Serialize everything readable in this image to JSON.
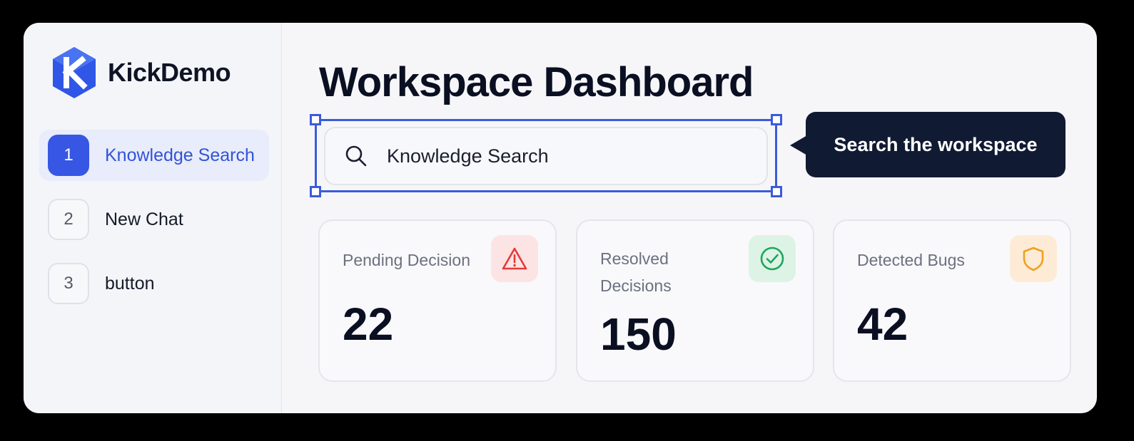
{
  "app": {
    "name": "KickDemo",
    "brand_color": "#3756e3"
  },
  "sidebar": {
    "items": [
      {
        "number": "1",
        "label": "Knowledge Search",
        "active": true
      },
      {
        "number": "2",
        "label": "New Chat",
        "active": false
      },
      {
        "number": "3",
        "label": "button",
        "active": false
      }
    ]
  },
  "main": {
    "title": "Workspace Dashboard",
    "search": {
      "value": "Knowledge Search",
      "icon": "search-icon"
    },
    "tooltip": {
      "text": "Search the workspace"
    },
    "cards": [
      {
        "label": "Pending Decision",
        "value": "22",
        "icon": "warning-icon",
        "accent": "#e23b3b"
      },
      {
        "label": "Resolved Decisions",
        "value": "150",
        "icon": "check-circle-icon",
        "accent": "#1fa65a"
      },
      {
        "label": "Detected Bugs",
        "value": "42",
        "icon": "shield-icon",
        "accent": "#f0a020"
      }
    ]
  },
  "colors": {
    "selection": "#3b5bdb",
    "tooltip_bg": "#111a33",
    "text_dark": "#0a0f22"
  }
}
